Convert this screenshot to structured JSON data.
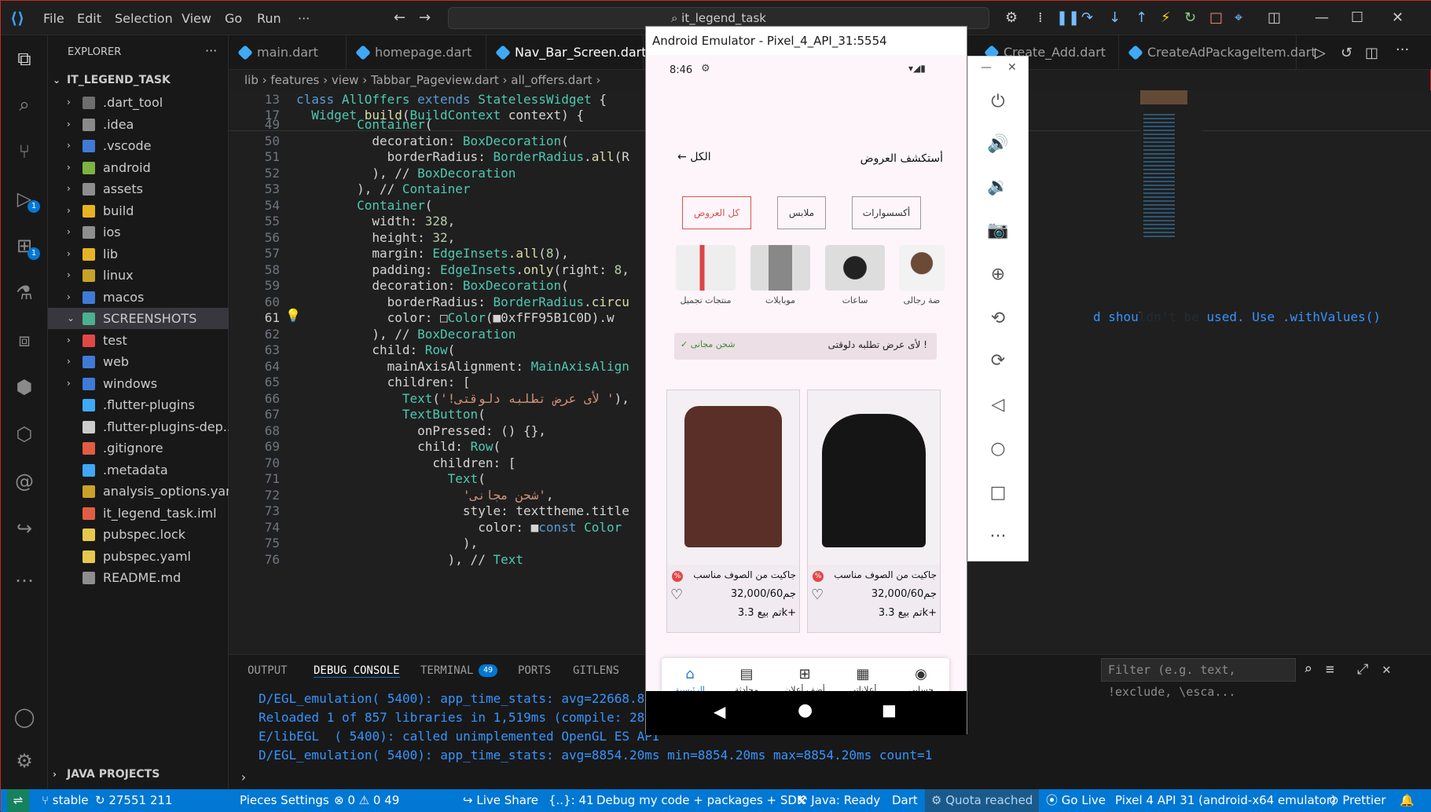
{
  "menu": [
    "File",
    "Edit",
    "Selection",
    "View",
    "Go",
    "Run",
    "···"
  ],
  "search": "it_legend_task",
  "explorer": {
    "title": "EXPLORER",
    "project": "IT_LEGEND_TASK",
    "items": [
      ".dart_tool",
      ".idea",
      ".vscode",
      "android",
      "assets",
      "build",
      "ios",
      "lib",
      "linux",
      "macos",
      "SCREENSHOTS",
      "test",
      "web",
      "windows",
      ".flutter-plugins",
      ".flutter-plugins-dep...",
      ".gitignore",
      ".metadata",
      "analysis_options.yaml",
      "it_legend_task.iml",
      "pubspec.lock",
      "pubspec.yaml",
      "README.md"
    ],
    "java": "JAVA PROJECTS"
  },
  "tabs": [
    "main.dart",
    "homepage.dart",
    "Nav_Bar_Screen.dart",
    "Create_Add.dart",
    "CreateAdPackageItem.dart"
  ],
  "breadcrumb": "lib › features › view › Tabbar_Pageview.dart › all_offers.dart ›",
  "sticky": [
    {
      "n": "13",
      "t": "class AllOffers extends StatelessWidget {"
    },
    {
      "n": "17",
      "t": "  Widget build(BuildContext context) {"
    }
  ],
  "code": [
    {
      "n": "49",
      "t": "        Container("
    },
    {
      "n": "50",
      "t": "          decoration: BoxDecoration("
    },
    {
      "n": "51",
      "t": "            borderRadius: BorderRadius.all(R"
    },
    {
      "n": "52",
      "t": "          ), // BoxDecoration"
    },
    {
      "n": "53",
      "t": "        ), // Container"
    },
    {
      "n": "54",
      "t": "        Container("
    },
    {
      "n": "55",
      "t": "          width: 328,"
    },
    {
      "n": "56",
      "t": "          height: 32,"
    },
    {
      "n": "57",
      "t": "          margin: EdgeInsets.all(8),"
    },
    {
      "n": "58",
      "t": "          padding: EdgeInsets.only(right: 8,"
    },
    {
      "n": "59",
      "t": "          decoration: BoxDecoration("
    },
    {
      "n": "60",
      "t": "            borderRadius: BorderRadius.circu"
    },
    {
      "n": "61",
      "t": "            color: □Color(■0xfFF95B1C0D).w"
    },
    {
      "n": "62",
      "t": "          ), // BoxDecoration"
    },
    {
      "n": "63",
      "t": "          child: Row("
    },
    {
      "n": "64",
      "t": "            mainAxisAlignment: MainAxisAlign"
    },
    {
      "n": "65",
      "t": "            children: ["
    },
    {
      "n": "66",
      "t": "              Text('!لأى عرض تطلبه دلوقتى '),"
    },
    {
      "n": "67",
      "t": "              TextButton("
    },
    {
      "n": "68",
      "t": "                onPressed: () {},"
    },
    {
      "n": "69",
      "t": "                child: Row("
    },
    {
      "n": "70",
      "t": "                  children: ["
    },
    {
      "n": "71",
      "t": "                    Text("
    },
    {
      "n": "72",
      "t": "                      'شحن مجانى',"
    },
    {
      "n": "73",
      "t": "                      style: texttheme.title"
    },
    {
      "n": "74",
      "t": "                        color: ■const Color"
    },
    {
      "n": "75",
      "t": "                      ),"
    },
    {
      "n": "76",
      "t": "                    ), // Text"
    }
  ],
  "hint": "d shouldn't be used. Use .withValues()",
  "panel": {
    "tabs": [
      "OUTPUT",
      "DEBUG CONSOLE",
      "TERMINAL",
      "PORTS",
      "GITLENS"
    ],
    "terminal_count": "49",
    "filter": "Filter (e.g. text, !exclude, \\esca...",
    "lines": [
      "D/EGL_emulation( 5400): app_time_stats: avg=22668.8",
      "Reloaded 1 of 857 libraries in 1,519ms (compile: 28",
      "E/libEGL  ( 5400): called unimplemented OpenGL ES API",
      "D/EGL_emulation( 5400): app_time_stats: avg=8854.20ms min=8854.20ms max=8854.20ms count=1"
    ]
  },
  "status": [
    "stable",
    "27551 211",
    "Pieces Settings",
    "⊗ 0 ⚠ 0 49",
    "Live Share",
    "{..}: 41",
    "Debug my code + packages + SDK",
    "Java: Ready",
    "Dart",
    "Quota reached",
    "Go Live",
    "Pixel 4 API 31 (android-x64 emulator)",
    "Prettier"
  ],
  "emulator": {
    "title": "Android Emulator - Pixel_4_API_31:5554",
    "time": "8:46",
    "header_title": "أستكشف العروض",
    "header_all": "الكل",
    "chips": [
      "كل العروض",
      "ملابس",
      "أكسسوارات"
    ],
    "categories": [
      "منتجات تجميل",
      "موبايلات",
      "ساعات",
      "ضة رجالى"
    ],
    "banner_text": "! لأى عرض تطلبه دلوقتى",
    "banner_action": "شحن مجانى",
    "products": [
      {
        "title": "جاكيت من الصوف مناسب",
        "price": "جم32,000/60",
        "sold": "+kتم بيع 3.3"
      },
      {
        "title": "جاكيت من الصوف مناسب",
        "price": "جم32,000/60",
        "sold": "+kتم بيع 3.3"
      }
    ],
    "bottom_nav": [
      "الرئيسية",
      "محادثة",
      "أضف أعلان",
      "أعلاناتى",
      "حسابى"
    ]
  }
}
